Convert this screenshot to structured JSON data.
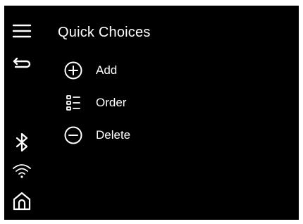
{
  "screen": {
    "title": "Quick Choices",
    "accent_color": "#000000",
    "text_color": "#ffffff"
  },
  "sidebar": {
    "icons": [
      "menu-icon",
      "back-icon",
      "bluetooth-icon",
      "wifi-icon",
      "home-icon"
    ]
  },
  "menu": {
    "items": [
      {
        "label": "Add",
        "icon": "plus-circle-icon"
      },
      {
        "label": "Order",
        "icon": "reorder-list-icon"
      },
      {
        "label": "Delete",
        "icon": "minus-circle-icon"
      }
    ]
  }
}
